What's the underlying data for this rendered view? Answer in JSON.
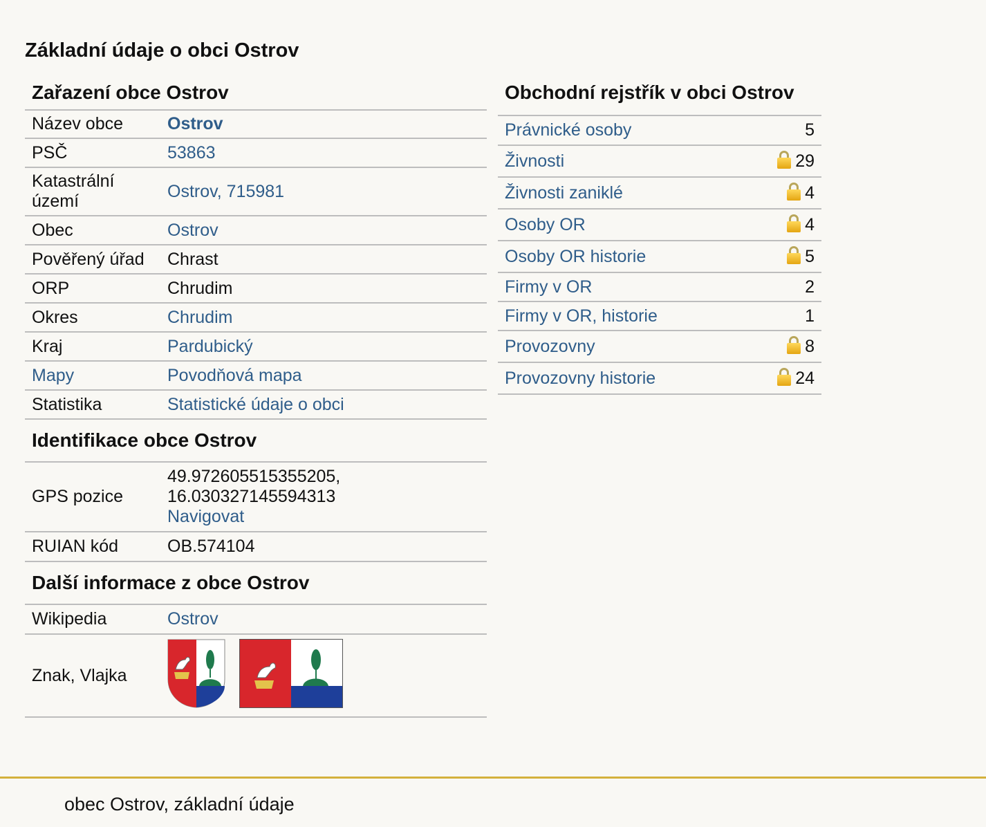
{
  "page_title": "Základní údaje o obci Ostrov",
  "classification": {
    "title": "Zařazení obce Ostrov",
    "rows": [
      {
        "label": "Název obce",
        "value": "Ostrov",
        "link": true,
        "bold": true,
        "label_link": false
      },
      {
        "label": "PSČ",
        "value": "53863",
        "link": true,
        "bold": false,
        "label_link": false
      },
      {
        "label": "Katastrální území",
        "value": "Ostrov, 715981",
        "link": true,
        "bold": false,
        "label_link": false
      },
      {
        "label": "Obec",
        "value": "Ostrov",
        "link": true,
        "bold": false,
        "label_link": false
      },
      {
        "label": "Pověřený úřad",
        "value": "Chrast",
        "link": false,
        "bold": false,
        "label_link": false
      },
      {
        "label": "ORP",
        "value": "Chrudim",
        "link": false,
        "bold": false,
        "label_link": false
      },
      {
        "label": "Okres",
        "value": "Chrudim",
        "link": true,
        "bold": false,
        "label_link": false
      },
      {
        "label": "Kraj",
        "value": "Pardubický",
        "link": true,
        "bold": false,
        "label_link": false
      },
      {
        "label": "Mapy",
        "value": "Povodňová mapa",
        "link": true,
        "bold": false,
        "label_link": true
      },
      {
        "label": "Statistika",
        "value": "Statistické údaje o obci",
        "link": true,
        "bold": false,
        "label_link": false
      }
    ]
  },
  "identification": {
    "title": "Identifikace obce Ostrov",
    "gps_label": "GPS pozice",
    "gps_lat": "49.972605515355205,",
    "gps_lon": "16.030327145594313",
    "navigate_label": "Navigovat",
    "ruian_label": "RUIAN kód",
    "ruian_value": "OB.574104"
  },
  "more": {
    "title": "Další informace z obce Ostrov",
    "wikipedia_label": "Wikipedia",
    "wikipedia_value": "Ostrov",
    "emblem_label": "Znak, Vlajka"
  },
  "registry": {
    "title": "Obchodní rejstřík v obci Ostrov",
    "rows": [
      {
        "label": "Právnické osoby",
        "count": "5",
        "locked": false
      },
      {
        "label": "Živnosti",
        "count": "29",
        "locked": true
      },
      {
        "label": "Živnosti zaniklé",
        "count": "4",
        "locked": true
      },
      {
        "label": "Osoby OR",
        "count": "4",
        "locked": true
      },
      {
        "label": "Osoby OR historie",
        "count": "5",
        "locked": true
      },
      {
        "label": "Firmy v OR",
        "count": "2",
        "locked": false
      },
      {
        "label": "Firmy v OR, historie",
        "count": "1",
        "locked": false
      },
      {
        "label": "Provozovny",
        "count": "8",
        "locked": true
      },
      {
        "label": "Provozovny historie",
        "count": "24",
        "locked": true
      }
    ]
  },
  "footer": {
    "text": "obec Ostrov, základní údaje"
  },
  "colors": {
    "link": "#2f5d8a",
    "footer_line": "#d4b13c",
    "background": "#f9f8f4",
    "emblem_red": "#d8262c",
    "emblem_blue": "#1e3f9a",
    "emblem_green": "#1f7a4d"
  }
}
